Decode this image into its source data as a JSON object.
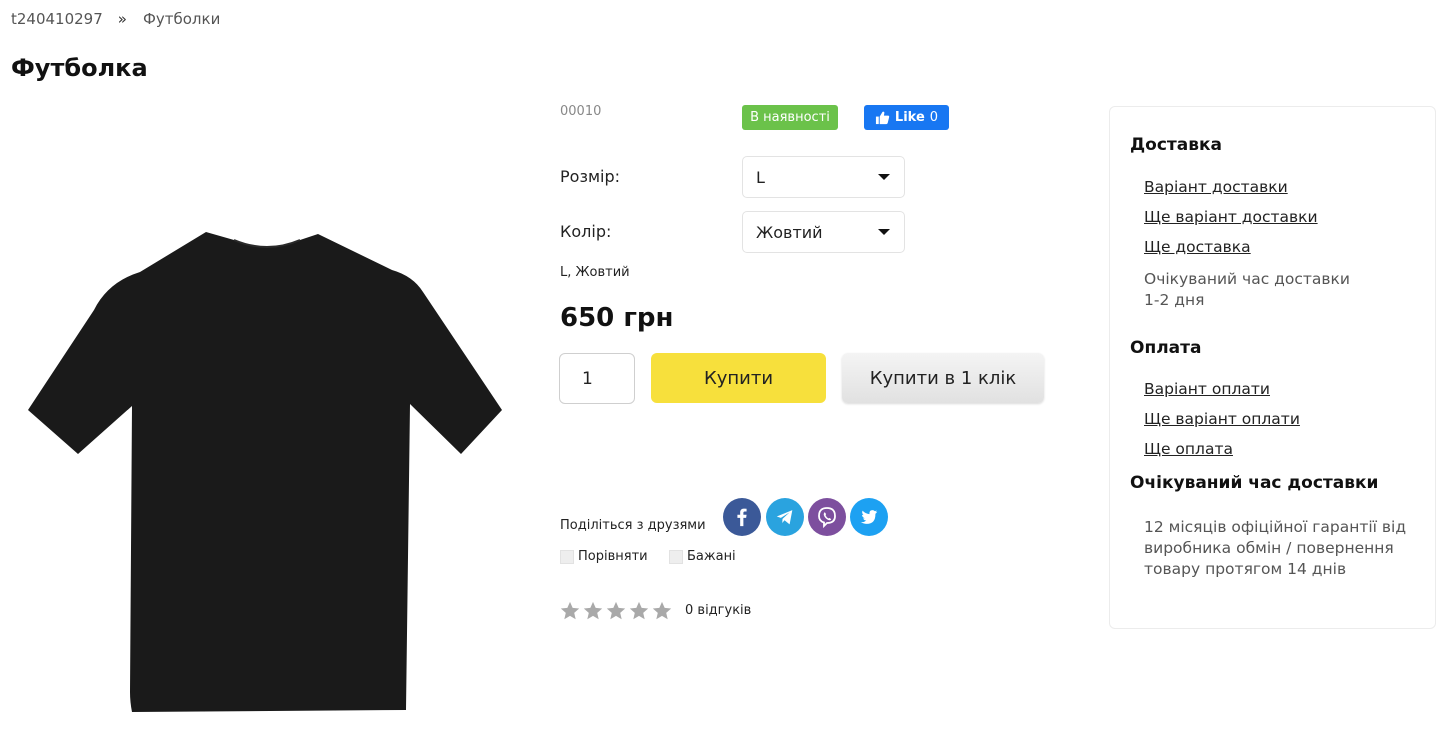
{
  "breadcrumb": {
    "home": "t240410297",
    "separator": "»",
    "category": "Футболки"
  },
  "product": {
    "title": "Футболка",
    "sku": "00010",
    "stock": "В наявності",
    "fb_like_label": "Like",
    "fb_like_count": "0",
    "image_icon": "black-tshirt-image",
    "size_label": "Розмір:",
    "size_value": "L",
    "color_label": "Колір:",
    "color_value": "Жовтий",
    "variant_summary": "L, Жовтий",
    "price": "650 грн",
    "quantity": "1",
    "buy_label": "Купити",
    "one_click_label": "Купити в 1 клік",
    "share_label": "Поділіться з друзями",
    "social_icons": [
      "facebook-icon",
      "telegram-icon",
      "viber-icon",
      "twitter-icon"
    ],
    "compare_label": "Порівняти",
    "wishlist_label": "Бажані",
    "rating": 0,
    "reviews_label": "0 відгуків"
  },
  "panel": {
    "delivery_heading": "Доставка",
    "delivery_links": [
      "Варіант доставки",
      "Ще варіант доставки",
      "Ще доставка"
    ],
    "delivery_time_line1": "Очікуваний час доставки",
    "delivery_time_line2": "1-2 дня",
    "payment_heading": "Оплата",
    "payment_links": [
      "Варіант оплати",
      "Ще варіант оплати",
      "Ще оплата"
    ],
    "warranty_heading": "Очікуваний час доставки",
    "warranty_line1": "12 місяців офіційної гарантії від",
    "warranty_line2": "виробника обмін / повернення",
    "warranty_line3": "товару протягом 14 днів"
  },
  "colors": {
    "stock_badge": "#6bc24a",
    "facebook": "#3b5998",
    "telegram": "#2aa3df",
    "viber": "#7d4f9e",
    "twitter": "#1da1f2",
    "buy_button": "#f7e03c",
    "star": "#a9a9a9"
  }
}
